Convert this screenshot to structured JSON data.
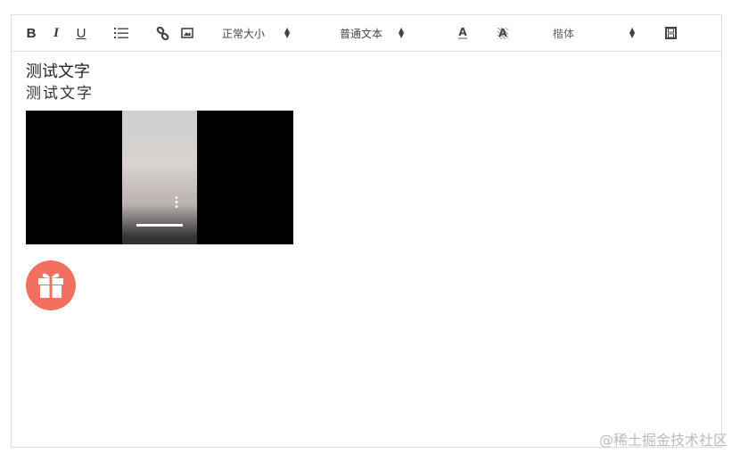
{
  "toolbar": {
    "bold": "B",
    "italic": "I",
    "underline": "U",
    "size_select": "正常大小",
    "header_select": "普通文本",
    "font_select": "楷体",
    "icons": [
      "bold-icon",
      "italic-icon",
      "underline-icon",
      "list-icon",
      "link-icon",
      "image-icon",
      "text-color-icon",
      "background-color-icon",
      "video-icon"
    ]
  },
  "content": {
    "line1": "测试文字",
    "line2": "测试文字"
  },
  "colors": {
    "gift": "#f2705f",
    "border": "#dddddd"
  },
  "watermark": "@稀土掘金技术社区"
}
